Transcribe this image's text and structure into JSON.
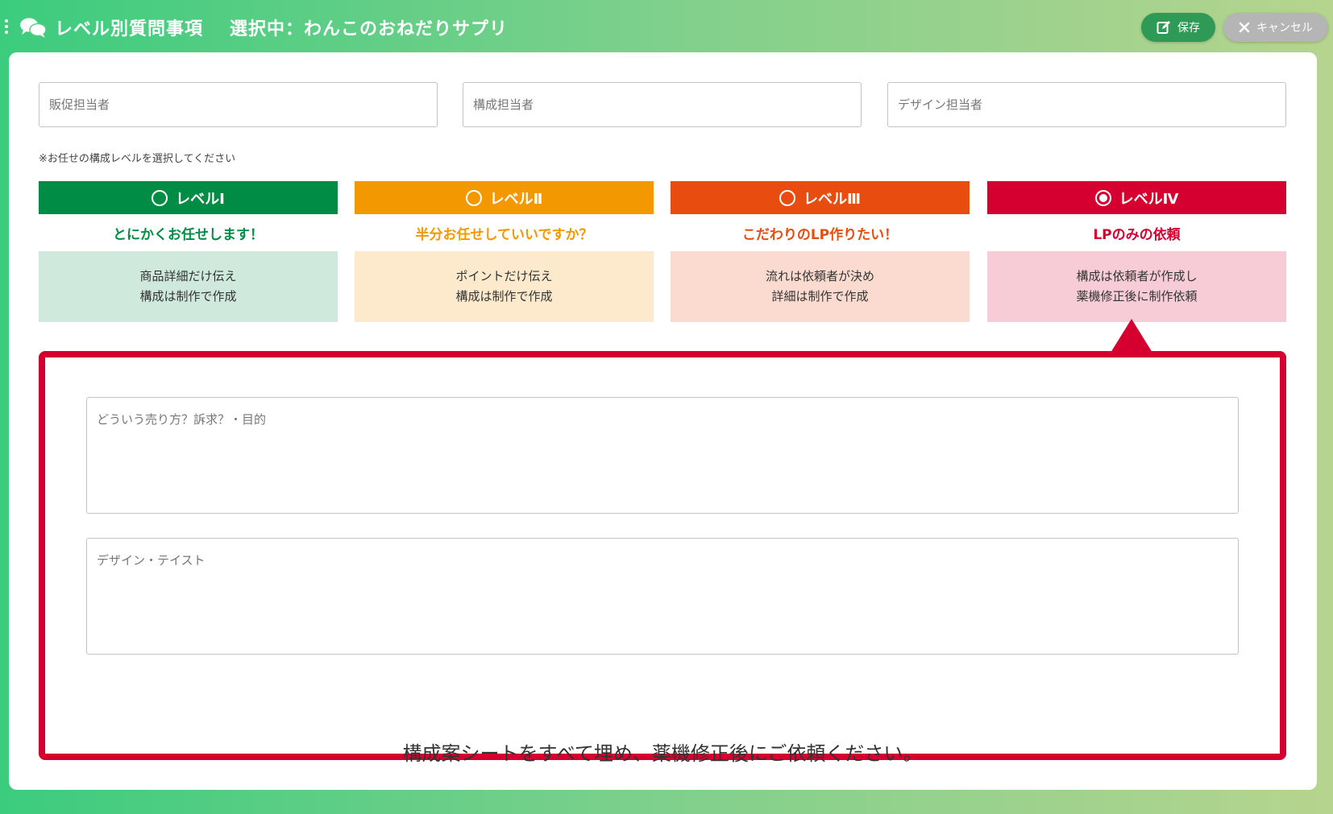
{
  "header": {
    "title": "レベル別質問事項",
    "selected": "選択中：わんこのおねだりサプリ",
    "save_label": "保存",
    "cancel_label": "キャンセル"
  },
  "inputs": [
    {
      "placeholder": "販促担当者",
      "value": ""
    },
    {
      "placeholder": "構成担当者",
      "value": ""
    },
    {
      "placeholder": "デザイン担当者",
      "value": ""
    }
  ],
  "hint": "※お任せの構成レベルを選択してください",
  "levels": [
    {
      "label": "レベルⅠ",
      "tagline": "とにかくお任せします！",
      "line1": "商品詳細だけ伝え",
      "line2": "構成は制作で作成",
      "color": "#008c45",
      "text_color": "#008c45",
      "bg": "#cfe9dc",
      "selected": false
    },
    {
      "label": "レベルⅡ",
      "tagline": "半分お任せしていいですか？",
      "line1": "ポイントだけ伝え",
      "line2": "構成は制作で作成",
      "color": "#f39800",
      "text_color": "#f39800",
      "bg": "#fdeacc",
      "selected": false
    },
    {
      "label": "レベルⅢ",
      "tagline": "こだわりのLP作りたい！",
      "line1": "流れは依頼者が決め",
      "line2": "詳細は制作で作成",
      "color": "#e94c0f",
      "text_color": "#e94c0f",
      "bg": "#fbdacf",
      "selected": false
    },
    {
      "label": "レベルⅣ",
      "tagline": "LPのみの依頼",
      "line1": "構成は依頼者が作成し",
      "line2": "薬機修正後に制作依頼",
      "color": "#d60030",
      "text_color": "#d60030",
      "bg": "#f7ccd6",
      "selected": true
    }
  ],
  "detail": {
    "textarea1_placeholder": "どういう売り方？訴求？・目的",
    "textarea2_placeholder": "デザイン・テイスト",
    "notice": "構成案シートをすべて埋め、薬機修正後にご依頼ください。"
  }
}
